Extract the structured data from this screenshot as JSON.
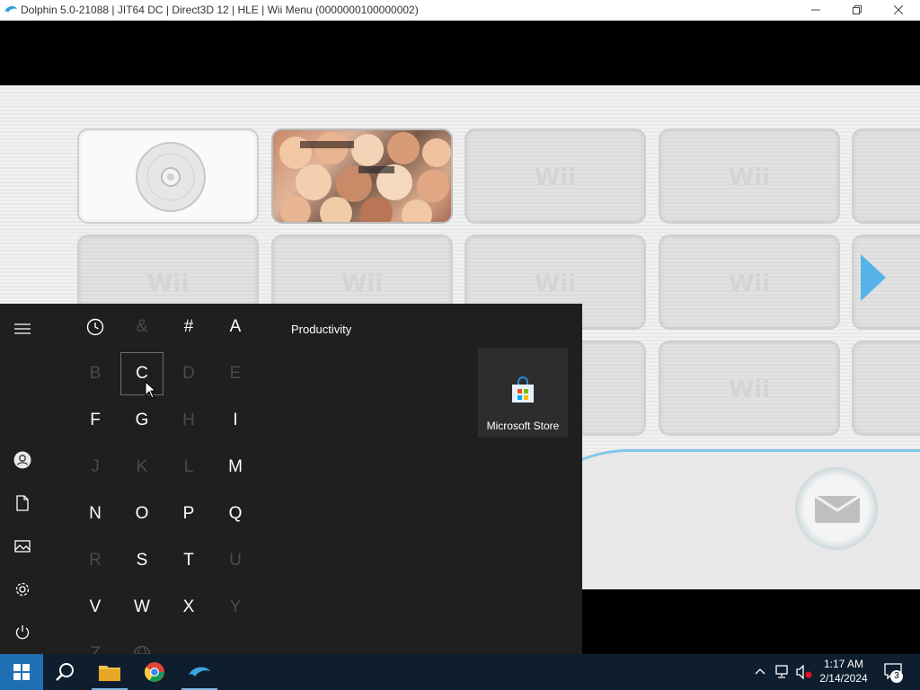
{
  "window": {
    "title": "Dolphin 5.0-21088 | JIT64 DC | Direct3D 12 | HLE | Wii Menu (0000000100000002)",
    "minimize_icon": "minimize-icon",
    "maximize_icon": "restore-icon",
    "close_icon": "close-icon"
  },
  "wii_menu": {
    "channel_label": "Wii",
    "channels": [
      {
        "name": "Disc Channel"
      },
      {
        "name": "Mii Channel"
      }
    ],
    "arrow_icon": "arrow-right-icon",
    "mail_icon": "envelope-icon"
  },
  "start_menu": {
    "rail": [
      "menu-icon",
      "user-icon",
      "documents-icon",
      "pictures-icon",
      "settings-icon",
      "power-icon"
    ],
    "letters": [
      {
        "label": "",
        "enabled": true,
        "icon": "clock-icon"
      },
      {
        "label": "&",
        "enabled": false
      },
      {
        "label": "#",
        "enabled": true
      },
      {
        "label": "A",
        "enabled": true
      },
      {
        "label": "B",
        "enabled": false
      },
      {
        "label": "C",
        "enabled": true,
        "focused": true
      },
      {
        "label": "D",
        "enabled": false
      },
      {
        "label": "E",
        "enabled": false
      },
      {
        "label": "F",
        "enabled": true
      },
      {
        "label": "G",
        "enabled": true
      },
      {
        "label": "H",
        "enabled": false
      },
      {
        "label": "I",
        "enabled": true
      },
      {
        "label": "J",
        "enabled": false
      },
      {
        "label": "K",
        "enabled": false
      },
      {
        "label": "L",
        "enabled": false
      },
      {
        "label": "M",
        "enabled": true
      },
      {
        "label": "N",
        "enabled": true
      },
      {
        "label": "O",
        "enabled": true
      },
      {
        "label": "P",
        "enabled": true
      },
      {
        "label": "Q",
        "enabled": true
      },
      {
        "label": "R",
        "enabled": false
      },
      {
        "label": "S",
        "enabled": true
      },
      {
        "label": "T",
        "enabled": true
      },
      {
        "label": "U",
        "enabled": false
      },
      {
        "label": "V",
        "enabled": true
      },
      {
        "label": "W",
        "enabled": true
      },
      {
        "label": "X",
        "enabled": true
      },
      {
        "label": "Y",
        "enabled": false
      },
      {
        "label": "Z",
        "enabled": false
      },
      {
        "label": "",
        "enabled": false,
        "icon": "globe-icon"
      }
    ],
    "section_title": "Productivity",
    "tiles": [
      {
        "label": "Microsoft Store",
        "icon": "microsoft-store-icon"
      }
    ]
  },
  "taskbar": {
    "apps": [
      "windows-start-icon",
      "search-icon",
      "file-explorer-icon",
      "chrome-icon",
      "dolphin-icon"
    ],
    "time": "1:17 AM",
    "date": "2/14/2024",
    "notification_count": "3",
    "colors": {
      "background": "#0f1e2e",
      "start_active": "#1f6fb5"
    }
  }
}
